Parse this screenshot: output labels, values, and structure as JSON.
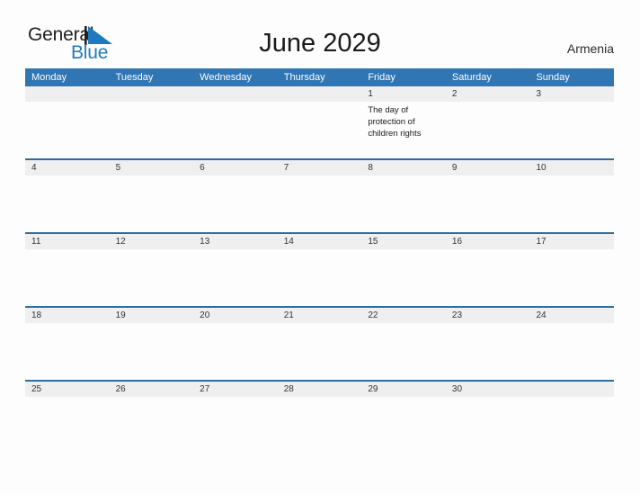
{
  "brand": {
    "name_part1": "General",
    "name_part2": "Blue",
    "flag_icon": "blue-flag-triangle"
  },
  "header": {
    "title": "June 2029",
    "country": "Armenia"
  },
  "colors": {
    "header_blue": "#3075b4",
    "rule_blue": "#2e6da4",
    "date_band_gray": "#efefef",
    "brand_blue": "#1f7bc1",
    "page_background": "#fdfdfd"
  },
  "calendar": {
    "weekdays": [
      "Monday",
      "Tuesday",
      "Wednesday",
      "Thursday",
      "Friday",
      "Saturday",
      "Sunday"
    ],
    "weeks": [
      {
        "days": [
          {
            "date": "",
            "event": ""
          },
          {
            "date": "",
            "event": ""
          },
          {
            "date": "",
            "event": ""
          },
          {
            "date": "",
            "event": ""
          },
          {
            "date": "1",
            "event": "The day of protection of children rights"
          },
          {
            "date": "2",
            "event": ""
          },
          {
            "date": "3",
            "event": ""
          }
        ]
      },
      {
        "days": [
          {
            "date": "4",
            "event": ""
          },
          {
            "date": "5",
            "event": ""
          },
          {
            "date": "6",
            "event": ""
          },
          {
            "date": "7",
            "event": ""
          },
          {
            "date": "8",
            "event": ""
          },
          {
            "date": "9",
            "event": ""
          },
          {
            "date": "10",
            "event": ""
          }
        ]
      },
      {
        "days": [
          {
            "date": "11",
            "event": ""
          },
          {
            "date": "12",
            "event": ""
          },
          {
            "date": "13",
            "event": ""
          },
          {
            "date": "14",
            "event": ""
          },
          {
            "date": "15",
            "event": ""
          },
          {
            "date": "16",
            "event": ""
          },
          {
            "date": "17",
            "event": ""
          }
        ]
      },
      {
        "days": [
          {
            "date": "18",
            "event": ""
          },
          {
            "date": "19",
            "event": ""
          },
          {
            "date": "20",
            "event": ""
          },
          {
            "date": "21",
            "event": ""
          },
          {
            "date": "22",
            "event": ""
          },
          {
            "date": "23",
            "event": ""
          },
          {
            "date": "24",
            "event": ""
          }
        ]
      },
      {
        "days": [
          {
            "date": "25",
            "event": ""
          },
          {
            "date": "26",
            "event": ""
          },
          {
            "date": "27",
            "event": ""
          },
          {
            "date": "28",
            "event": ""
          },
          {
            "date": "29",
            "event": ""
          },
          {
            "date": "30",
            "event": ""
          },
          {
            "date": "",
            "event": ""
          }
        ]
      }
    ]
  }
}
